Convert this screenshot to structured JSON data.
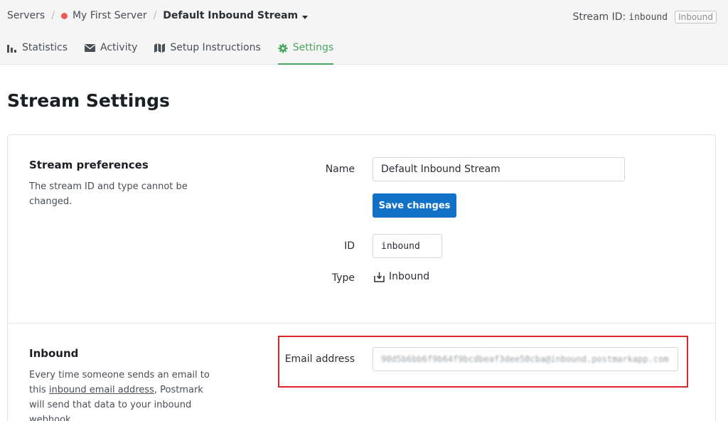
{
  "breadcrumb": {
    "servers": "Servers",
    "separator": "/",
    "server_name": "My First Server",
    "server_status_color": "#ef5b52",
    "stream_name": "Default Inbound Stream"
  },
  "stream_id": {
    "label": "Stream ID:",
    "value": "inbound",
    "badge": "Inbound"
  },
  "tabs": [
    {
      "label": "Statistics",
      "icon": "bar-chart-icon"
    },
    {
      "label": "Activity",
      "icon": "envelope-icon"
    },
    {
      "label": "Setup Instructions",
      "icon": "map-icon"
    },
    {
      "label": "Settings",
      "icon": "gear-icon",
      "active": true
    }
  ],
  "colors": {
    "accent_green": "#4aa564",
    "primary_blue": "#1071c7",
    "highlight_red": "#d8262c"
  },
  "page_title": "Stream Settings",
  "preferences": {
    "title": "Stream preferences",
    "description": "The stream ID and type cannot be changed.",
    "name_label": "Name",
    "name_value": "Default Inbound Stream",
    "save_label": "Save changes",
    "id_label": "ID",
    "id_value": "inbound",
    "type_label": "Type",
    "type_value": "Inbound",
    "type_icon": "inbound-tray-icon"
  },
  "inbound": {
    "title": "Inbound",
    "desc_before": "Every time someone sends an email to this ",
    "desc_link": "inbound email address",
    "desc_after": ", Postmark will send that data to your inbound webhook",
    "email_label": "Email address",
    "email_value": "90d5b6bb6f9b64f9bcdbeaf3dee50cba@inbound.postmarkapp.com"
  }
}
